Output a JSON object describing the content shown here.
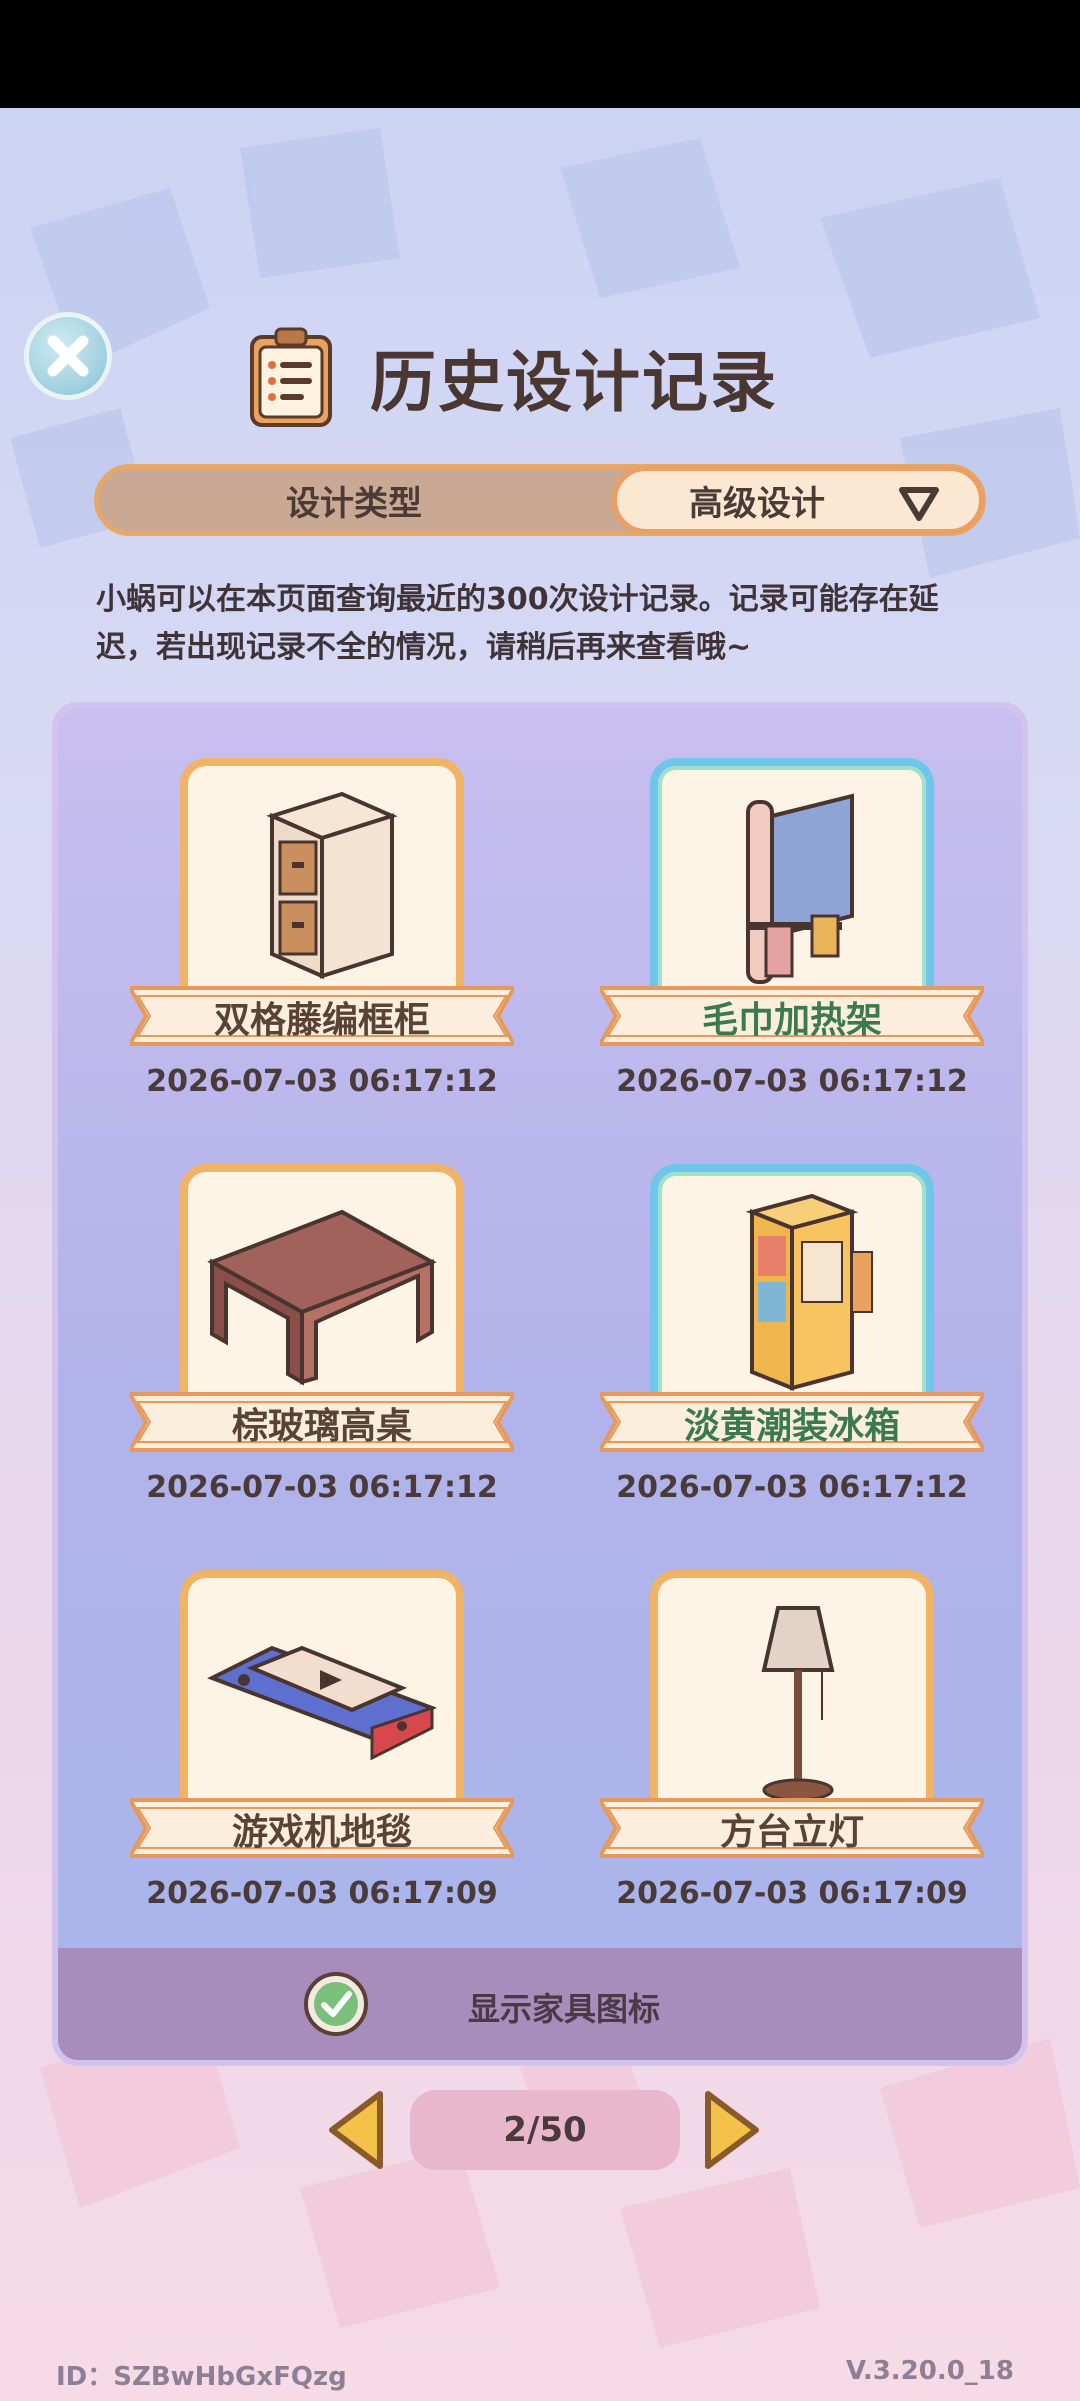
{
  "header": {
    "title": "历史设计记录"
  },
  "tabs": {
    "type_label": "设计类型",
    "selected_value": "高级设计"
  },
  "notice": "小蜗可以在本页面查询最近的300次设计记录。记录可能存在延迟，若出现记录不全的情况，请稍后再来查看哦~",
  "records": [
    {
      "name": "双格藤编框柜",
      "date": "2026-07-03 06:17:12",
      "frame": "gold",
      "icon": "cabinet-icon"
    },
    {
      "name": "毛巾加热架",
      "date": "2026-07-03 06:17:12",
      "frame": "blue",
      "icon": "towel-rack-icon"
    },
    {
      "name": "棕玻璃高桌",
      "date": "2026-07-03 06:17:12",
      "frame": "gold",
      "icon": "glass-table-icon"
    },
    {
      "name": "淡黄潮装冰箱",
      "date": "2026-07-03 06:17:12",
      "frame": "blue",
      "icon": "fridge-icon"
    },
    {
      "name": "游戏机地毯",
      "date": "2026-07-03 06:17:09",
      "frame": "gold",
      "icon": "game-console-rug-icon"
    },
    {
      "name": "方台立灯",
      "date": "2026-07-03 06:17:09",
      "frame": "gold",
      "icon": "floor-lamp-icon"
    }
  ],
  "footer_toggle": {
    "label": "显示家具图标",
    "checked": true
  },
  "pager": {
    "text": "2/50"
  },
  "footer": {
    "id": "ID：SZBwHbGxFQzg",
    "version": "V.3.20.0_18"
  },
  "colors": {
    "accent_gold": "#f1b466",
    "accent_blue": "#6fc6ea",
    "text_dark": "#4a3732",
    "name_green": "#3a7a4c"
  }
}
